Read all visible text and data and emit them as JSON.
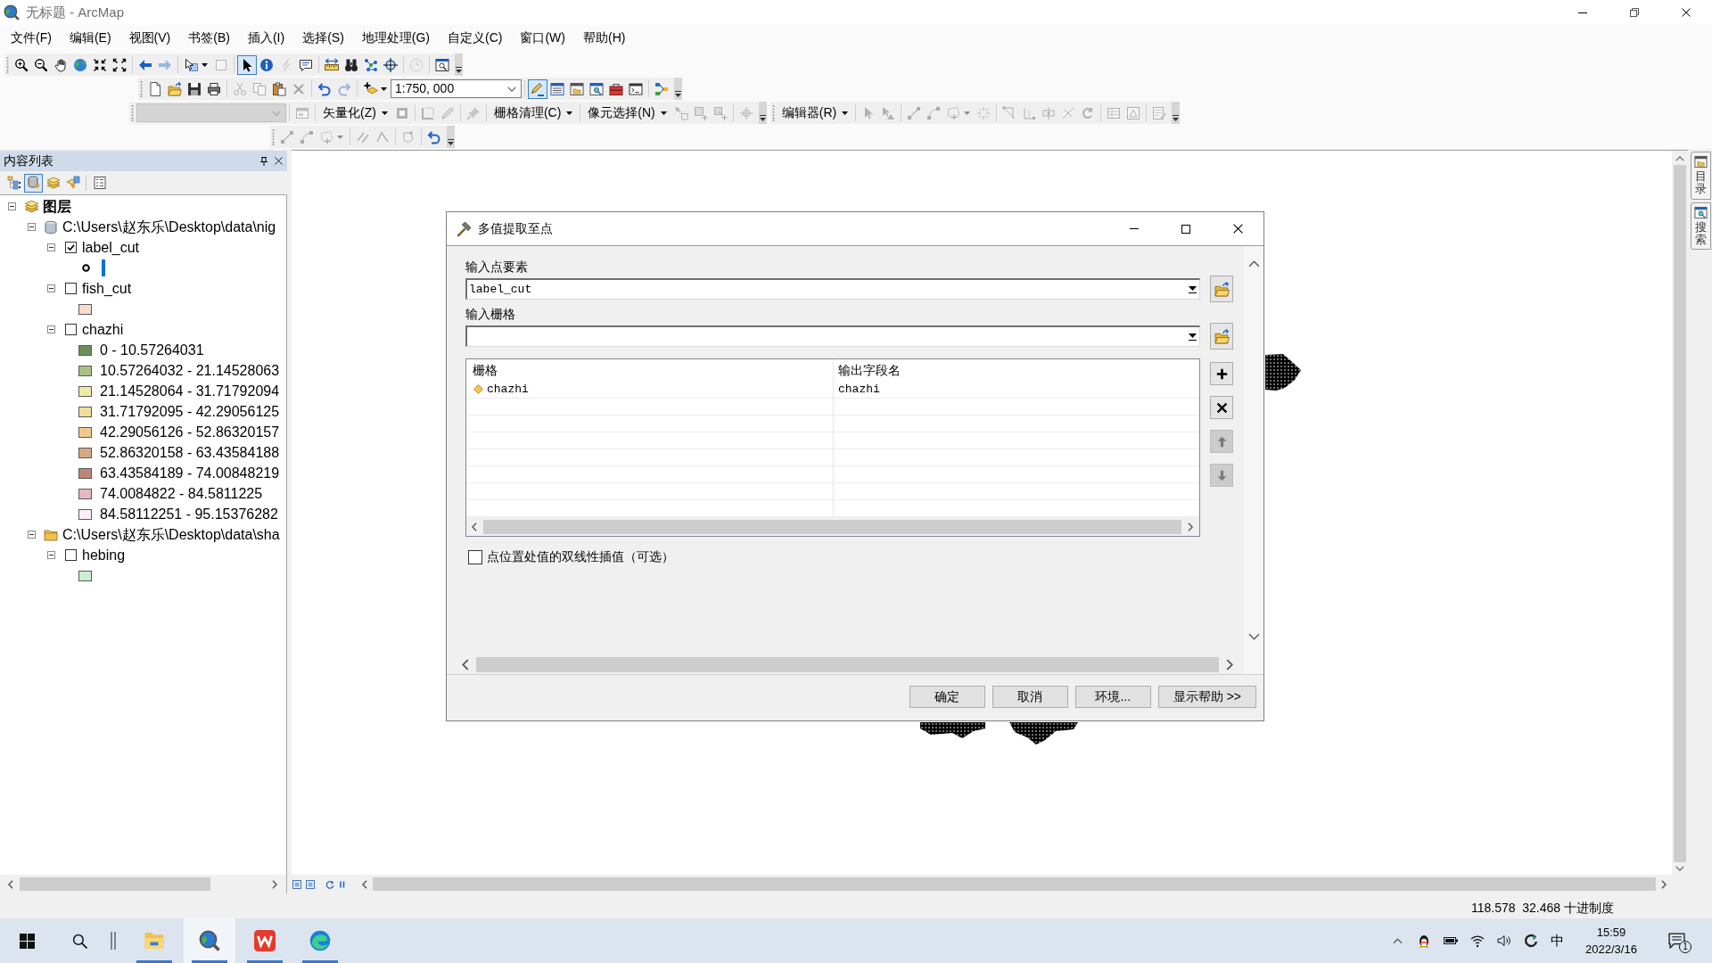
{
  "window": {
    "title": "无标题 - ArcMap"
  },
  "menu": [
    "文件(F)",
    "编辑(E)",
    "视图(V)",
    "书签(B)",
    "插入(I)",
    "选择(S)",
    "地理处理(G)",
    "自定义(C)",
    "窗口(W)",
    "帮助(H)"
  ],
  "toolbar_rows": [
    [
      {
        "items": [
          {
            "kind": "button",
            "disabled": false,
            "selected": false
          },
          {
            "kind": "button",
            "disabled": false,
            "selected": false
          },
          {
            "kind": "button",
            "disabled": false,
            "selected": false
          },
          {
            "kind": "button",
            "disabled": false,
            "selected": false
          },
          {
            "kind": "button",
            "disabled": false,
            "selected": false
          },
          {
            "kind": "button",
            "disabled": false,
            "selected": false
          },
          {
            "kind": "separator"
          },
          {
            "kind": "button",
            "disabled": false,
            "selected": false
          },
          {
            "kind": "button",
            "disabled": true,
            "selected": false
          },
          {
            "kind": "separator"
          },
          {
            "kind": "dropdown",
            "disabled": false,
            "selected": false
          },
          {
            "kind": "button",
            "disabled": true,
            "selected": false
          },
          {
            "kind": "separator"
          },
          {
            "kind": "button",
            "disabled": false,
            "selected": true
          },
          {
            "kind": "button",
            "disabled": false,
            "selected": false
          },
          {
            "kind": "button",
            "disabled": true,
            "selected": false
          },
          {
            "kind": "button",
            "disabled": false,
            "selected": false
          },
          {
            "kind": "separator"
          },
          {
            "kind": "button",
            "disabled": false,
            "selected": false
          },
          {
            "kind": "button",
            "disabled": false,
            "selected": false
          },
          {
            "kind": "button",
            "disabled": false,
            "selected": false
          },
          {
            "kind": "button",
            "disabled": false,
            "selected": false
          },
          {
            "kind": "separator"
          },
          {
            "kind": "button",
            "disabled": true,
            "selected": false
          },
          {
            "kind": "separator"
          },
          {
            "kind": "button",
            "disabled": false,
            "selected": false
          }
        ]
      }
    ],
    [
      {
        "items": [
          {
            "kind": "button",
            "disabled": false,
            "selected": false
          },
          {
            "kind": "button",
            "disabled": false,
            "selected": false
          },
          {
            "kind": "button",
            "disabled": false,
            "selected": false
          },
          {
            "kind": "button",
            "disabled": false,
            "selected": false
          },
          {
            "kind": "separator"
          },
          {
            "kind": "button",
            "disabled": true,
            "selected": false
          },
          {
            "kind": "button",
            "disabled": true,
            "selected": false
          },
          {
            "kind": "button",
            "disabled": false,
            "selected": false
          },
          {
            "kind": "button",
            "disabled": true,
            "selected": false
          },
          {
            "kind": "separator"
          },
          {
            "kind": "button",
            "disabled": false,
            "selected": false
          },
          {
            "kind": "button",
            "disabled": true,
            "selected": false
          },
          {
            "kind": "separator"
          },
          {
            "kind": "dropdown",
            "disabled": false,
            "selected": false
          },
          {
            "kind": "combo",
            "value": "1:750, 000",
            "disabled": false
          },
          {
            "kind": "separator"
          },
          {
            "kind": "button",
            "disabled": false,
            "selected": true
          },
          {
            "kind": "button",
            "disabled": false,
            "selected": false
          },
          {
            "kind": "button",
            "disabled": false,
            "selected": false
          },
          {
            "kind": "button",
            "disabled": false,
            "selected": false
          },
          {
            "kind": "button",
            "disabled": false,
            "selected": false
          },
          {
            "kind": "button",
            "disabled": false,
            "selected": false
          },
          {
            "kind": "separator"
          },
          {
            "kind": "button",
            "disabled": false,
            "selected": false
          }
        ]
      }
    ],
    [
      {
        "items": [
          {
            "kind": "combo",
            "disabled": true
          },
          {
            "kind": "separator"
          },
          {
            "kind": "button",
            "disabled": true,
            "selected": false
          },
          {
            "kind": "separator"
          },
          {
            "kind": "menu",
            "label": "矢量化(Z)"
          },
          {
            "kind": "button",
            "disabled": true,
            "selected": false
          },
          {
            "kind": "separator"
          },
          {
            "kind": "button",
            "disabled": true,
            "selected": false
          },
          {
            "kind": "button",
            "disabled": true,
            "selected": false
          },
          {
            "kind": "separator"
          },
          {
            "kind": "button",
            "disabled": true,
            "selected": false
          },
          {
            "kind": "separator"
          },
          {
            "kind": "menu",
            "label": "栅格清理(C)"
          },
          {
            "kind": "separator"
          },
          {
            "kind": "menu",
            "label": "像元选择(N)"
          },
          {
            "kind": "button",
            "disabled": true,
            "selected": false
          },
          {
            "kind": "button",
            "disabled": true,
            "selected": false
          },
          {
            "kind": "button",
            "disabled": true,
            "selected": false
          },
          {
            "kind": "separator"
          },
          {
            "kind": "button",
            "disabled": true,
            "selected": false
          }
        ]
      },
      {
        "items": [
          {
            "kind": "menu",
            "label": "编辑器(R)"
          },
          {
            "kind": "separator"
          },
          {
            "kind": "button",
            "disabled": true,
            "selected": false
          },
          {
            "kind": "button",
            "disabled": true,
            "selected": false
          },
          {
            "kind": "separator"
          },
          {
            "kind": "button",
            "disabled": true,
            "selected": false
          },
          {
            "kind": "button",
            "disabled": true,
            "selected": false
          },
          {
            "kind": "dropdown",
            "disabled": true,
            "selected": false
          },
          {
            "kind": "button",
            "disabled": true,
            "selected": false
          },
          {
            "kind": "separator"
          },
          {
            "kind": "button",
            "disabled": true,
            "selected": false
          },
          {
            "kind": "button",
            "disabled": true,
            "selected": false
          },
          {
            "kind": "button",
            "disabled": true,
            "selected": false
          },
          {
            "kind": "button",
            "disabled": true,
            "selected": false
          },
          {
            "kind": "button",
            "disabled": true,
            "selected": false
          },
          {
            "kind": "separator"
          },
          {
            "kind": "button",
            "disabled": true,
            "selected": false
          },
          {
            "kind": "button",
            "disabled": true,
            "selected": false
          },
          {
            "kind": "separator"
          },
          {
            "kind": "button",
            "disabled": true,
            "selected": false
          }
        ]
      }
    ],
    [
      {
        "items": [
          {
            "kind": "button",
            "disabled": true,
            "selected": false
          },
          {
            "kind": "button",
            "disabled": true,
            "selected": false
          },
          {
            "kind": "dropdown",
            "disabled": true,
            "selected": false
          },
          {
            "kind": "separator"
          },
          {
            "kind": "button",
            "disabled": true,
            "selected": false
          },
          {
            "kind": "button",
            "disabled": true,
            "selected": false
          },
          {
            "kind": "separator"
          },
          {
            "kind": "button",
            "disabled": true,
            "selected": false
          },
          {
            "kind": "separator"
          },
          {
            "kind": "button",
            "disabled": false,
            "selected": false
          }
        ]
      }
    ]
  ],
  "toc": {
    "title": "内容列表",
    "list_by": [
      {
        "selected": false
      },
      {
        "selected": true
      },
      {
        "selected": false
      },
      {
        "selected": false
      }
    ],
    "tree": [
      {
        "kind": "group",
        "label": "图层",
        "expanded": true,
        "children": [
          {
            "kind": "database",
            "label": "C:\\Users\\赵东乐\\Desktop\\data\\nig",
            "expanded": true,
            "children": [
              {
                "kind": "layer",
                "label": "label_cut",
                "checked": true,
                "expanded": true,
                "legend": [
                  {
                    "kind": "point",
                    "selected": true
                  }
                ]
              },
              {
                "kind": "layer",
                "label": "fish_cut",
                "checked": false,
                "expanded": true,
                "legend": [
                  {
                    "kind": "fill",
                    "color": "#f8dccc",
                    "selected": false
                  }
                ]
              },
              {
                "kind": "layer",
                "label": "chazhi",
                "checked": false,
                "expanded": true,
                "legend": [
                  {
                    "kind": "fill",
                    "color": "#6b8e5c",
                    "label": "0 - 10.57264031",
                    "selected": false
                  },
                  {
                    "kind": "fill",
                    "color": "#a9c283",
                    "label": "10.57264032 - 21.14528063",
                    "selected": false
                  },
                  {
                    "kind": "fill",
                    "color": "#efeaa8",
                    "label": "21.14528064 - 31.71792094",
                    "selected": false
                  },
                  {
                    "kind": "fill",
                    "color": "#f0dc9e",
                    "label": "31.71792095 - 42.29056125",
                    "selected": false
                  },
                  {
                    "kind": "fill",
                    "color": "#efca8b",
                    "label": "42.29056126 - 52.86320157",
                    "selected": false
                  },
                  {
                    "kind": "fill",
                    "color": "#d8a886",
                    "label": "52.86320158 - 63.43584188",
                    "selected": false
                  },
                  {
                    "kind": "fill",
                    "color": "#be8678",
                    "label": "63.43584189 - 74.00848219",
                    "selected": false
                  },
                  {
                    "kind": "fill",
                    "color": "#e4b9c2",
                    "label": "74.0084822 - 84.5811225",
                    "selected": false
                  },
                  {
                    "kind": "fill",
                    "color": "#fbeefa",
                    "label": "84.58112251 - 95.15376282",
                    "selected": false
                  }
                ]
              }
            ]
          },
          {
            "kind": "folder",
            "label": "C:\\Users\\赵东乐\\Desktop\\data\\sha",
            "expanded": true,
            "children": [
              {
                "kind": "layer",
                "label": "hebing",
                "checked": false,
                "expanded": true,
                "legend": [
                  {
                    "kind": "fill",
                    "color": "#c9efd5",
                    "selected": false
                  }
                ]
              }
            ]
          }
        ]
      }
    ]
  },
  "dialog": {
    "title": "多值提取至点",
    "fields": [
      {
        "label": "输入点要素",
        "value": "label_cut"
      },
      {
        "label": "输入栅格"
      }
    ],
    "table": {
      "columns": [
        "栅格",
        "输出字段名"
      ],
      "rows": [
        [
          "chazhi",
          "chazhi"
        ]
      ]
    },
    "side_buttons": [
      {
        "disabled": false
      },
      {
        "disabled": false
      },
      {
        "disabled": true
      },
      {
        "disabled": true
      }
    ],
    "option": {
      "label": "点位置处值的双线性插值（可选）",
      "checked": false
    },
    "buttons": [
      "确定",
      "取消",
      "环境...",
      "显示帮助 >>"
    ]
  },
  "side_tabs": [
    {
      "label": "目录"
    },
    {
      "label": "搜索"
    }
  ],
  "status_bar": {
    "coordinates": "118.578  32.468 十进制度"
  },
  "taskbar": {
    "apps": [
      {
        "selected": false,
        "running": true
      },
      {
        "selected": true,
        "running": true
      },
      {
        "selected": false,
        "running": true
      },
      {
        "selected": false,
        "running": true
      }
    ],
    "ime": "中",
    "time": "15:59",
    "date": "2022/3/16",
    "notifications": "1"
  }
}
